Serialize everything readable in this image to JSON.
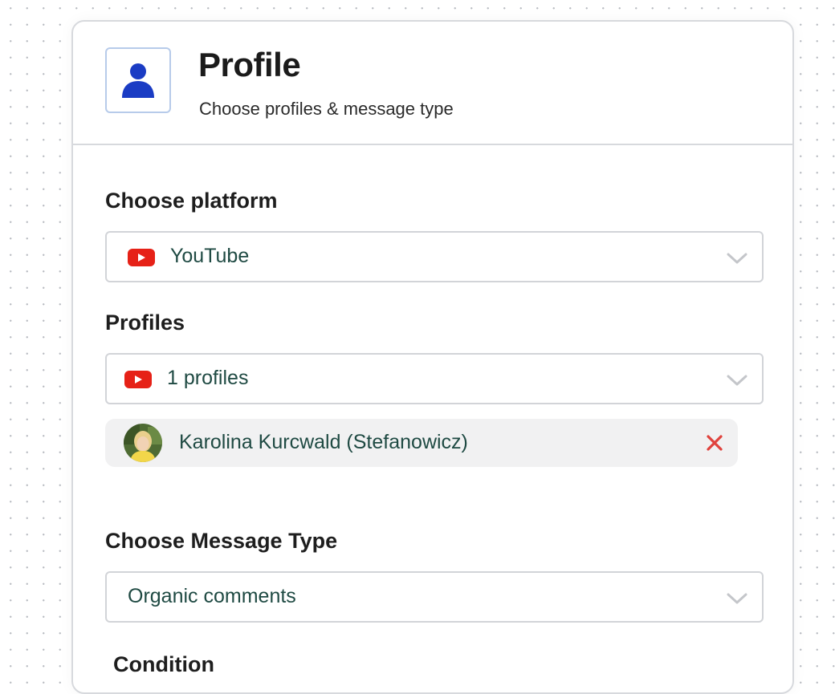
{
  "header": {
    "title": "Profile",
    "subtitle": "Choose profiles & message type",
    "icon": "user-icon",
    "icon_color": "#1a3cc4"
  },
  "platform": {
    "label": "Choose platform",
    "selected": "YouTube",
    "icon": "youtube-icon",
    "icon_color": "#e62117"
  },
  "profiles": {
    "label": "Profiles",
    "selected": "1 profiles",
    "icon": "youtube-icon",
    "items": [
      {
        "name": "Karolina Kurcwald (Stefanowicz)",
        "remove_icon": "close-icon",
        "remove_color": "#e0423d"
      }
    ]
  },
  "message_type": {
    "label": "Choose Message Type",
    "selected": "Organic comments"
  },
  "condition": {
    "label": "Condition"
  },
  "colors": {
    "value_text": "#1f4a43",
    "border": "#d2d4d8",
    "chip_bg": "#f1f1f2"
  }
}
